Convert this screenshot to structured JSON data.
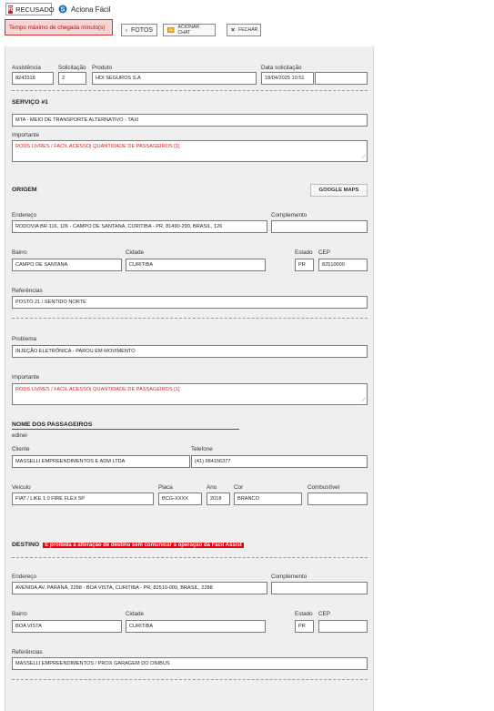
{
  "header": {
    "status_label": "RECUSADO",
    "app_title": "Aciona Fácil",
    "timer_label": "Tempo máximo de chegada minuto(s)",
    "photos_label": "FOTOS",
    "chat_label": "ACIONAR CHAT",
    "close_label": "FECHAR"
  },
  "summary": {
    "assistencia_label": "Assistência",
    "assistencia": "8243318",
    "solicitacao_label": "Solicitação",
    "solicitacao": "2",
    "produto_label": "Produto",
    "produto": "HDI SEGUROS S.A",
    "data_label": "Data solicitação",
    "data": "18/04/2025 10:51",
    "extra": ""
  },
  "service": {
    "title": "SERVIÇO #1",
    "service_value": "MTA - MEIO DE TRANSPORTE ALTERNATIVO - TAXI",
    "important_label": "Importante",
    "important_value": "RODS LIVRES / FACIL ACESSO| QUANTIDADE DE PASSAGEIROS [1]"
  },
  "origin": {
    "title": "ORIGEM",
    "maps_button": "GOOGLE MAPS",
    "address_label": "Endereço",
    "address": "RODOVIA BR-116, 126 - CAMPO DE SANTANA, CURITIBA - PR, 81490-290, BRASIL, 126",
    "complement_label": "Complemento",
    "complement": "",
    "bairro_label": "Bairro",
    "bairro": "CAMPO DE SANTANA",
    "cidade_label": "Cidade",
    "cidade": "CURITIBA",
    "estado_label": "Estado",
    "estado": "PR",
    "cep_label": "CEP",
    "cep": "82510000",
    "ref_label": "Referências",
    "ref": "POSTO 21 / SENTIDO NORTE"
  },
  "problem": {
    "problem_label": "Problema",
    "problem": "INJEÇÃO ELETRÔNICA - PAROU EM MOVIMENTO",
    "important_label": "Importante",
    "important_value": "RODS LIVRES / FACIL ACESSO| QUANTIDADE DE PASSAGEIROS [1]"
  },
  "passengers": {
    "title": "NOME DOS PASSAGEIROS",
    "name": "edinei",
    "client_label": "Cliente",
    "client": "MASSELLI EMPREENDIMENTOS E ADM LTDA",
    "phone_label": "Telefone",
    "phone": "(41) 984156377"
  },
  "vehicle": {
    "veiculo_label": "Veículo",
    "veiculo": "FIAT / LIKE 1.0 FIRE FLEX 5P",
    "placa_label": "Placa",
    "placa": "BCG-XXXX",
    "ano_label": "Ano",
    "ano": "2018",
    "cor_label": "Cor",
    "cor": "BRANCO",
    "combustivel_label": "Combustível",
    "combustivel": ""
  },
  "destination": {
    "title": "DESTINO",
    "warning": "É proibida a alteração de destino sem comunicar a operação da Fácil Assist",
    "address_label": "Endereço",
    "address": "AVENIDA AV. PARANÁ, 2288 - BOA VISTA, CURITIBA - PR, 82510-000, BRASIL, 2288",
    "complement_label": "Complemento",
    "complement": "",
    "bairro_label": "Bairro",
    "bairro": "BOA VISTA",
    "cidade_label": "Cidade",
    "cidade": "CURITIBA",
    "estado_label": "Estado",
    "estado": "PR",
    "cep_label": "CEP",
    "cep": "",
    "ref_label": "Referências",
    "ref": "MASSELLI EMPREENDIMENTOS / PROX GARAGEM DO ONIBUS"
  }
}
